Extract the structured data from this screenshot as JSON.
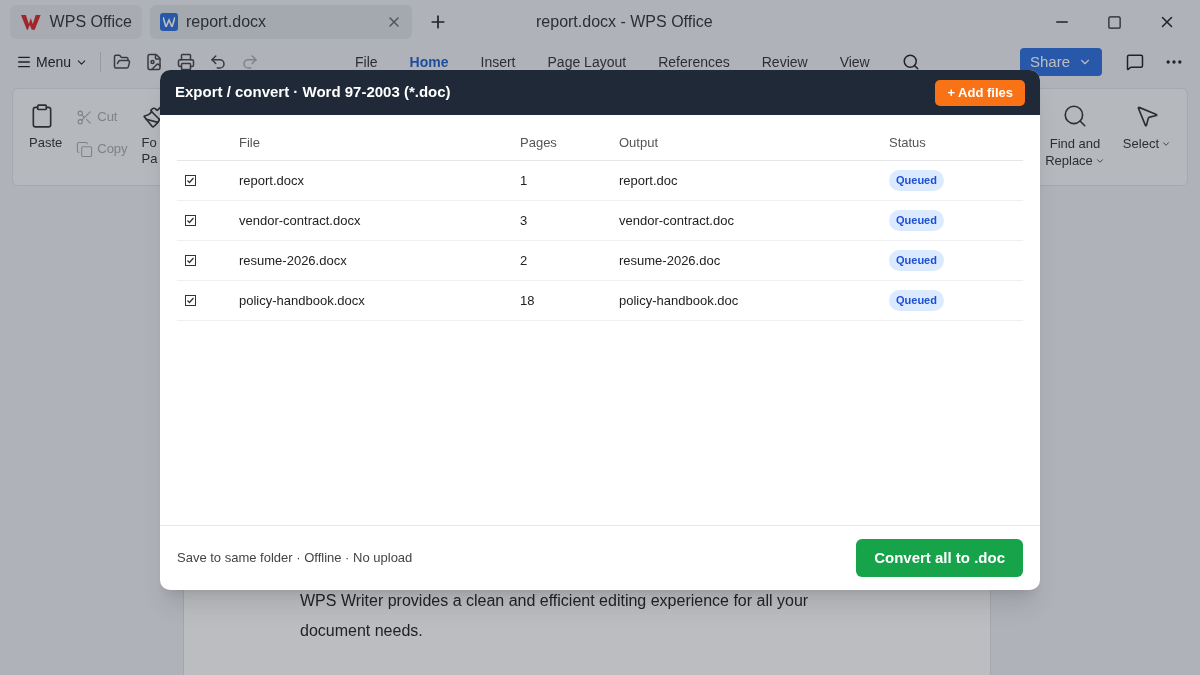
{
  "app_tabs": [
    {
      "kind": "home",
      "label": "WPS Office",
      "selected": false
    },
    {
      "kind": "document",
      "label": "report.docx",
      "selected": true
    }
  ],
  "window": {
    "title": "report.docx - WPS Office"
  },
  "toolbar": {
    "menu": "Menu",
    "tabs": [
      {
        "label": "File",
        "selected": false
      },
      {
        "label": "Home",
        "selected": true
      },
      {
        "label": "Insert",
        "selected": false
      },
      {
        "label": "Page Layout",
        "selected": false
      },
      {
        "label": "References",
        "selected": false
      },
      {
        "label": "Review",
        "selected": false
      },
      {
        "label": "View",
        "selected": false
      }
    ],
    "share": "Share"
  },
  "ribbon": {
    "left": [
      {
        "kind": "paste",
        "label": "Paste",
        "disabled": false
      },
      {
        "kind": "cut",
        "label": "Cut",
        "disabled": true
      },
      {
        "kind": "copy",
        "label": "Copy",
        "disabled": true
      },
      {
        "kind": "format",
        "label": "Fo",
        "label2": "Pa",
        "disabled": false
      }
    ],
    "right": [
      {
        "kind": "find",
        "label": "Find and",
        "label2": "Replace"
      },
      {
        "kind": "select",
        "label": "Select"
      }
    ]
  },
  "document": {
    "text": "WPS Writer provides a clean and efficient editing experience for all your document needs."
  },
  "dialog": {
    "title": "Export / convert · Word 97-2003 (*.doc)",
    "add_button": "+ Add files",
    "columns": [
      "File",
      "Pages",
      "Output",
      "Status"
    ],
    "rows": [
      {
        "checked": true,
        "file": "report.docx",
        "pages": "1",
        "output": "report.doc",
        "status": "Queued"
      },
      {
        "checked": true,
        "file": "vendor-contract.docx",
        "pages": "3",
        "output": "vendor-contract.doc",
        "status": "Queued"
      },
      {
        "checked": true,
        "file": "resume-2026.docx",
        "pages": "2",
        "output": "resume-2026.doc",
        "status": "Queued"
      },
      {
        "checked": true,
        "file": "policy-handbook.docx",
        "pages": "18",
        "output": "policy-handbook.doc",
        "status": "Queued"
      }
    ],
    "footer_note": "Save to same folder · Offline · No upload",
    "convert_button": "Convert all to .doc"
  }
}
